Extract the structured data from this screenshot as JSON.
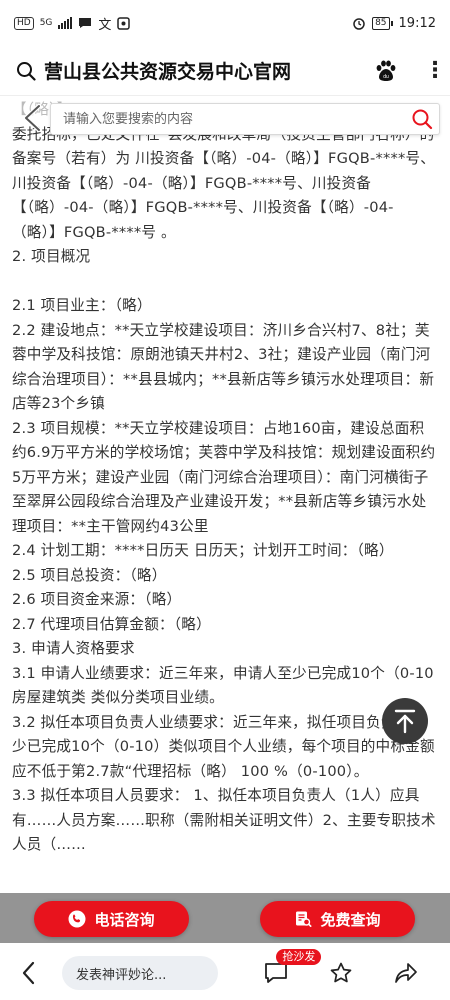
{
  "status_bar": {
    "hd": "HD",
    "network": "5G",
    "battery": "85",
    "time": "19:12"
  },
  "header": {
    "title": "营山县公共资源交易中心官网"
  },
  "search": {
    "placeholder": "请输入您要搜索的内容"
  },
  "article": {
    "lines": [
      "【（略）】……",
      "委托招标，已处文件在“县发展和改革局”（投资主管部门名称）的备案号（若有）为 川投资备【（略）-04-（略）】FGQB-****号、川投资备【（略）-04-（略）】FGQB-****号、川投资备【（略）-04-（略）】FGQB-****号、川投资备【（略）-04-（略）】FGQB-****号 。",
      "2. 项目概况",
      "",
      "2.1 项目业主：（略）",
      "2.2 建设地点：**天立学校建设项目：济川乡合兴村7、8社；芙蓉中学及科技馆：原朗池镇天井村2、3社；建设产业园（南门河综合治理项目）：**县县城内；**县新店等乡镇污水处理项目：新店等23个乡镇",
      "2.3 项目规模：**天立学校建设项目：占地160亩，建设总面积约6.9万平方米的学校场馆；芙蓉中学及科技馆：规划建设面积约5万平方米；建设产业园（南门河综合治理项目）：南门河横街子至翠屏公园段综合治理及产业建设开发；**县新店等乡镇污水处理项目：**主干管网约43公里",
      "2.4 计划工期：****日历天 日历天；计划开工时间：（略）",
      "2.5 项目总投资：（略）",
      "2.6 项目资金来源：（略）",
      "2.7 代理项目估算金额：（略）",
      "3. 申请人资格要求",
      "3.1 申请人业绩要求：近三年来，申请人至少已完成10个（0-10 房屋建筑类 类似分类项目业绩。",
      "3.2 拟任本项目负责人业绩要求：近三年来，拟任项目负责人至少已完成10个（0-10）类似项目个人业绩，每个项目的中标金额应不低于第2.7款“代理招标（略） 100 %（0-100）。",
      "3.3 拟任本项目人员要求： 1、拟任本项目负责人（1人）应具有……人员方案……职称（需附相关证明文件）2、主要专职技术人员（……"
    ]
  },
  "cta": {
    "phone_label": "电话咨询",
    "quote_label": "免费查询"
  },
  "bottom_nav": {
    "comment_placeholder": "发表神评妙论...",
    "badge": "抢沙发"
  },
  "colors": {
    "accent_red": "#e8131d",
    "overlay_dark": "#3a3a3a"
  },
  "icons": {
    "search": "search-icon",
    "paw": "baidu-paw-icon",
    "more": "more-vertical-icon",
    "back": "back-arrow-icon",
    "scroll_top": "arrow-up-icon",
    "phone": "phone-icon",
    "quote": "document-search-icon",
    "comment": "comment-icon",
    "star": "star-icon",
    "share": "share-icon"
  }
}
